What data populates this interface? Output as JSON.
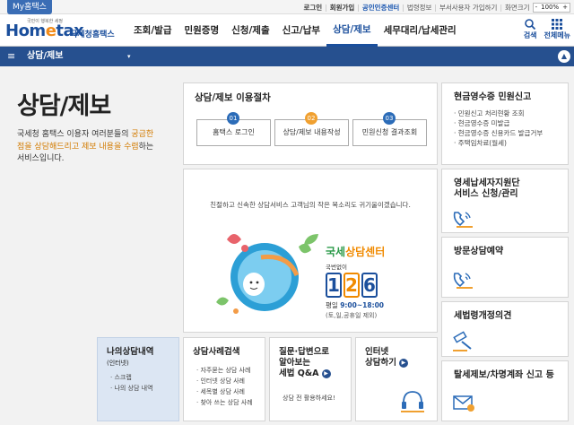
{
  "topbar": {
    "my_tab": "My홈택스",
    "links": {
      "login": "로그인",
      "join": "회원가입",
      "cert": "공인인증센터",
      "law": "법령정보",
      "dept": "부서사용자 가입하기",
      "screen": "화면크기"
    },
    "zoom": {
      "minus": "-",
      "value": "100%",
      "plus": "+"
    }
  },
  "header": {
    "logo_tiny": "국민이 행복한 세정",
    "logo_home": "Hom",
    "logo_e": "e",
    "logo_tax": "tax",
    "logo_nts": "국세청홈택스",
    "menu": [
      "조회/발급",
      "민원증명",
      "신청/제출",
      "신고/납부",
      "상담/제보",
      "세무대리/납세관리"
    ],
    "search_label": "검색",
    "all_menu_label": "전체메뉴"
  },
  "subnav": {
    "title": "상담/제보",
    "dropdown": "▾",
    "up": "▲"
  },
  "intro": {
    "title": "상담/제보",
    "desc_pre": "국세청 홈택스 이용자 여러분들의 ",
    "desc_hl": "궁금한 점을 상담해드리고 제보 내용을 수렴",
    "desc_post": "하는 서비스입니다."
  },
  "procedure": {
    "title": "상담/제보 이용절차",
    "steps": [
      {
        "num": "01",
        "label": "홈택스 로그인",
        "color": "#2c6cb8"
      },
      {
        "num": "02",
        "label": "상담/제보 내용작성",
        "color": "#f0a030"
      },
      {
        "num": "03",
        "label": "민원신청 결과조회",
        "color": "#2c6cb8"
      }
    ]
  },
  "banner": {
    "text": "친절하고 신속한 상담서비스 고객님의 작은 목소리도 귀기울이겠습니다.",
    "brand_pre": "국세",
    "brand_post": "상담센터",
    "no_code": "국번없이",
    "digits": [
      "1",
      "2",
      "6"
    ],
    "hours_label": "평일",
    "hours": "9:00~18:00",
    "holiday": "(토,일,공휴일 제외)"
  },
  "right": {
    "receipt": {
      "title": "현금영수증 민원신고",
      "items": [
        "민원신고 처리현황 조회",
        "현금영수증 미발급",
        "현금영수증 신용카드 발급거부",
        "주택임차료(월세)"
      ]
    },
    "smallbiz": {
      "title_line1": "영세납세자지원단",
      "title_line2": "서비스 신청/관리"
    },
    "visit": {
      "title": "방문상담예약"
    },
    "law": {
      "title": "세법령개정의견"
    },
    "report": {
      "title": "탈세제보/차명계좌 신고 등"
    }
  },
  "bottom": {
    "mycase": {
      "title_line1": "나의상담내역",
      "title_line2": "(인터넷)",
      "items": [
        "스크랩",
        "나의 상담 내역"
      ]
    },
    "casesearch": {
      "title": "상담사례검색",
      "items": [
        "자주묻는 상담 사례",
        "인터넷 상담 사례",
        "세목별 상담 사례",
        "찾아 쓰는 상담 사례"
      ]
    },
    "faq": {
      "title_line1": "질문·답변으로",
      "title_line2": "알아보는",
      "title_line3": "세법 Q&A",
      "sub": "상담 전 활용하세요!"
    },
    "internet": {
      "title_line1": "인터넷",
      "title_line2": "상담하기"
    }
  },
  "colors": {
    "brand_blue": "#1b4f9c",
    "subnav": "#26508f",
    "accent_orange": "#f0a030",
    "green": "#2b9a49"
  }
}
